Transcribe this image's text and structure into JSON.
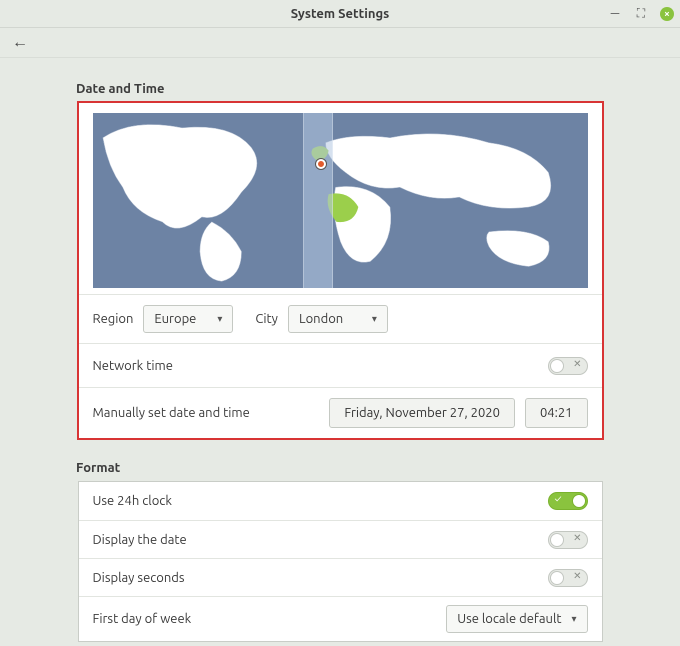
{
  "window": {
    "title": "System Settings"
  },
  "sections": {
    "datetime_title": "Date and Time",
    "format_title": "Format"
  },
  "region_row": {
    "region_label": "Region",
    "region_value": "Europe",
    "city_label": "City",
    "city_value": "London"
  },
  "network_time": {
    "label": "Network time",
    "enabled": false
  },
  "manual": {
    "label": "Manually set date and time",
    "date_value": "Friday, November 27, 2020",
    "time_value": "04:21"
  },
  "format": {
    "use24h": {
      "label": "Use 24h clock",
      "enabled": true
    },
    "display_date": {
      "label": "Display the date",
      "enabled": false
    },
    "display_seconds": {
      "label": "Display seconds",
      "enabled": false
    },
    "first_day": {
      "label": "First day of week",
      "value": "Use locale default"
    }
  }
}
